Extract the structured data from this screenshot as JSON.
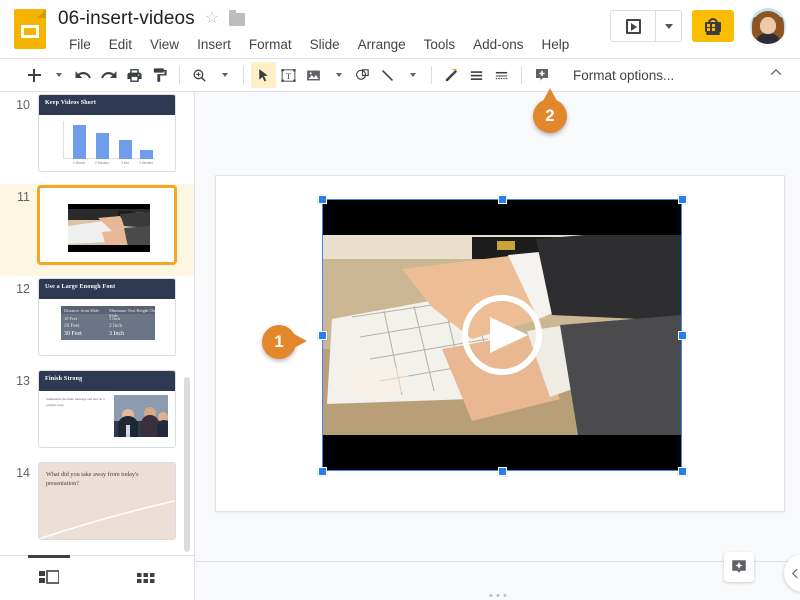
{
  "app": {
    "name": "Google Slides",
    "doc_title": "06-insert-videos",
    "doc_icon": "slides-file-icon",
    "star_icon": "☆",
    "folder_icon": "folder-icon"
  },
  "menubar": {
    "items": [
      {
        "label": "File"
      },
      {
        "label": "Edit"
      },
      {
        "label": "View"
      },
      {
        "label": "Insert"
      },
      {
        "label": "Format"
      },
      {
        "label": "Slide"
      },
      {
        "label": "Arrange"
      },
      {
        "label": "Tools"
      },
      {
        "label": "Add-ons"
      },
      {
        "label": "Help"
      }
    ]
  },
  "top_actions": {
    "present_label": "Present",
    "present_icon": "present-screen-icon",
    "present_caret_icon": "chevron-down-icon",
    "share_label": "Share",
    "share_icon": "lock-icon",
    "avatar_name": "user-avatar",
    "share_color": "#fbbc04"
  },
  "toolbar": {
    "items": [
      {
        "name": "new-slide-button",
        "icon": "plus-icon",
        "tooltip": "New slide"
      },
      {
        "name": "new-slide-dropdown",
        "icon": "chevron-down-icon",
        "tooltip": "New slide layout"
      },
      {
        "name": "undo-button",
        "icon": "undo-icon",
        "tooltip": "Undo"
      },
      {
        "name": "redo-button",
        "icon": "redo-icon",
        "tooltip": "Redo"
      },
      {
        "name": "print-button",
        "icon": "print-icon",
        "tooltip": "Print"
      },
      {
        "name": "paint-format-button",
        "icon": "paint-format-icon",
        "tooltip": "Paint format"
      },
      {
        "name": "zoom-button",
        "icon": "magnifier-icon",
        "tooltip": "Zoom"
      },
      {
        "name": "zoom-dropdown",
        "icon": "chevron-down-icon",
        "tooltip": "Zoom options"
      },
      {
        "name": "select-tool-button",
        "icon": "cursor-arrow-icon",
        "tooltip": "Select",
        "active": true
      },
      {
        "name": "text-box-button",
        "icon": "text-box-icon",
        "tooltip": "Text box"
      },
      {
        "name": "insert-image-button",
        "icon": "image-icon",
        "tooltip": "Insert image"
      },
      {
        "name": "insert-image-dropdown",
        "icon": "chevron-down-icon",
        "tooltip": "Image options"
      },
      {
        "name": "shape-button",
        "icon": "shape-icon",
        "tooltip": "Shape"
      },
      {
        "name": "line-button",
        "icon": "line-icon",
        "tooltip": "Line"
      },
      {
        "name": "line-dropdown",
        "icon": "chevron-down-icon",
        "tooltip": "Line options"
      },
      {
        "name": "pen-button",
        "icon": "pen-icon",
        "tooltip": "Pen"
      },
      {
        "name": "background-button",
        "icon": "lines-icon",
        "tooltip": "Background"
      },
      {
        "name": "transition-button",
        "icon": "transition-icon",
        "tooltip": "Transition"
      },
      {
        "name": "add-comment-button",
        "icon": "comment-plus-icon",
        "tooltip": "Add comment"
      }
    ],
    "format_options_label": "Format options...",
    "collapse_icon": "chevron-up-icon"
  },
  "filmstrip": {
    "slides": [
      {
        "number": "10",
        "title": "Keep Videos Short",
        "type": "chart",
        "selected": false,
        "chart_bars": [
          {
            "label": "1 Minute",
            "height": 34
          },
          {
            "label": "2 Minutes",
            "height": 26
          },
          {
            "label": "3 Min",
            "height": 19
          },
          {
            "label": "5 Minutes",
            "height": 9
          }
        ]
      },
      {
        "number": "11",
        "title": "",
        "type": "video",
        "selected": true
      },
      {
        "number": "12",
        "title": "Use a Large Enough Font",
        "type": "table",
        "selected": false,
        "table": {
          "headers": [
            "Distance from Slide",
            "Minimum Text Height On Slide"
          ],
          "rows": [
            [
              "10 Feet",
              "1 Inch"
            ],
            [
              "20 Feet",
              "2 Inch"
            ],
            [
              "30 Feet",
              "3 Inch"
            ]
          ]
        }
      },
      {
        "number": "13",
        "title": "Finish Strong",
        "type": "text-image",
        "selected": false,
        "body": "Summarize the main message and end on a positive note."
      },
      {
        "number": "14",
        "title": "",
        "type": "question",
        "selected": false,
        "body": "What did you take away from today's presentation?"
      }
    ],
    "scrollbar_name": "filmstrip-scrollbar"
  },
  "view_toggles": [
    {
      "name": "filmstrip-view-button",
      "icon": "filmstrip-view-icon",
      "selected": true
    },
    {
      "name": "grid-view-button",
      "icon": "grid-view-icon",
      "selected": false
    }
  ],
  "canvas": {
    "selected_object": "video-placeholder",
    "play_button_icon": "play-circle-icon",
    "selection_color": "#4285f4",
    "handle_count": 8
  },
  "notes": {
    "explore_icon": "explore-star-icon",
    "side_panel_icon": "chevron-left-icon",
    "grip_name": "notes-resize-grip"
  },
  "callouts": [
    {
      "number": "1",
      "direction": "right",
      "target": "video-left-handle",
      "color": "#e3872d"
    },
    {
      "number": "2",
      "direction": "up",
      "target": "format-options-button",
      "color": "#e3872d"
    }
  ]
}
